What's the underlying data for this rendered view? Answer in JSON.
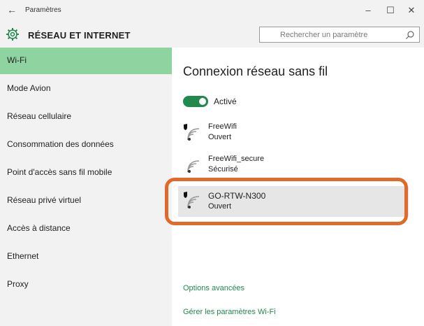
{
  "window": {
    "title": "Paramètres",
    "back_icon": "back-arrow-icon",
    "controls": {
      "minimize": "–",
      "maximize": "☐",
      "close": "✕"
    }
  },
  "header": {
    "title": "RÉSEAU ET INTERNET",
    "icon": "gear-icon",
    "search_placeholder": "Rechercher un paramètre"
  },
  "sidebar": {
    "items": [
      {
        "label": "Wi-Fi",
        "active": true
      },
      {
        "label": "Mode Avion"
      },
      {
        "label": "Réseau cellulaire"
      },
      {
        "label": "Consommation des données"
      },
      {
        "label": "Point d'accès sans fil mobile"
      },
      {
        "label": "Réseau privé virtuel"
      },
      {
        "label": "Accès à distance"
      },
      {
        "label": "Ethernet"
      },
      {
        "label": "Proxy"
      }
    ]
  },
  "main": {
    "title": "Connexion réseau sans fil",
    "toggle_label": "Activé",
    "networks": [
      {
        "name": "FreeWifi",
        "status": "Ouvert"
      },
      {
        "name": "FreeWifi_secure",
        "status": "Sécurisé"
      },
      {
        "name": "GO-RTW-N300",
        "status": "Ouvert",
        "selected": true
      }
    ],
    "links": {
      "advanced": "Options avancées",
      "manage": "Gérer les paramètres Wi-Fi"
    }
  },
  "colors": {
    "accent": "#1f8a4c",
    "sidebar_active": "#8fd3a1",
    "highlight": "#e06a2b"
  }
}
